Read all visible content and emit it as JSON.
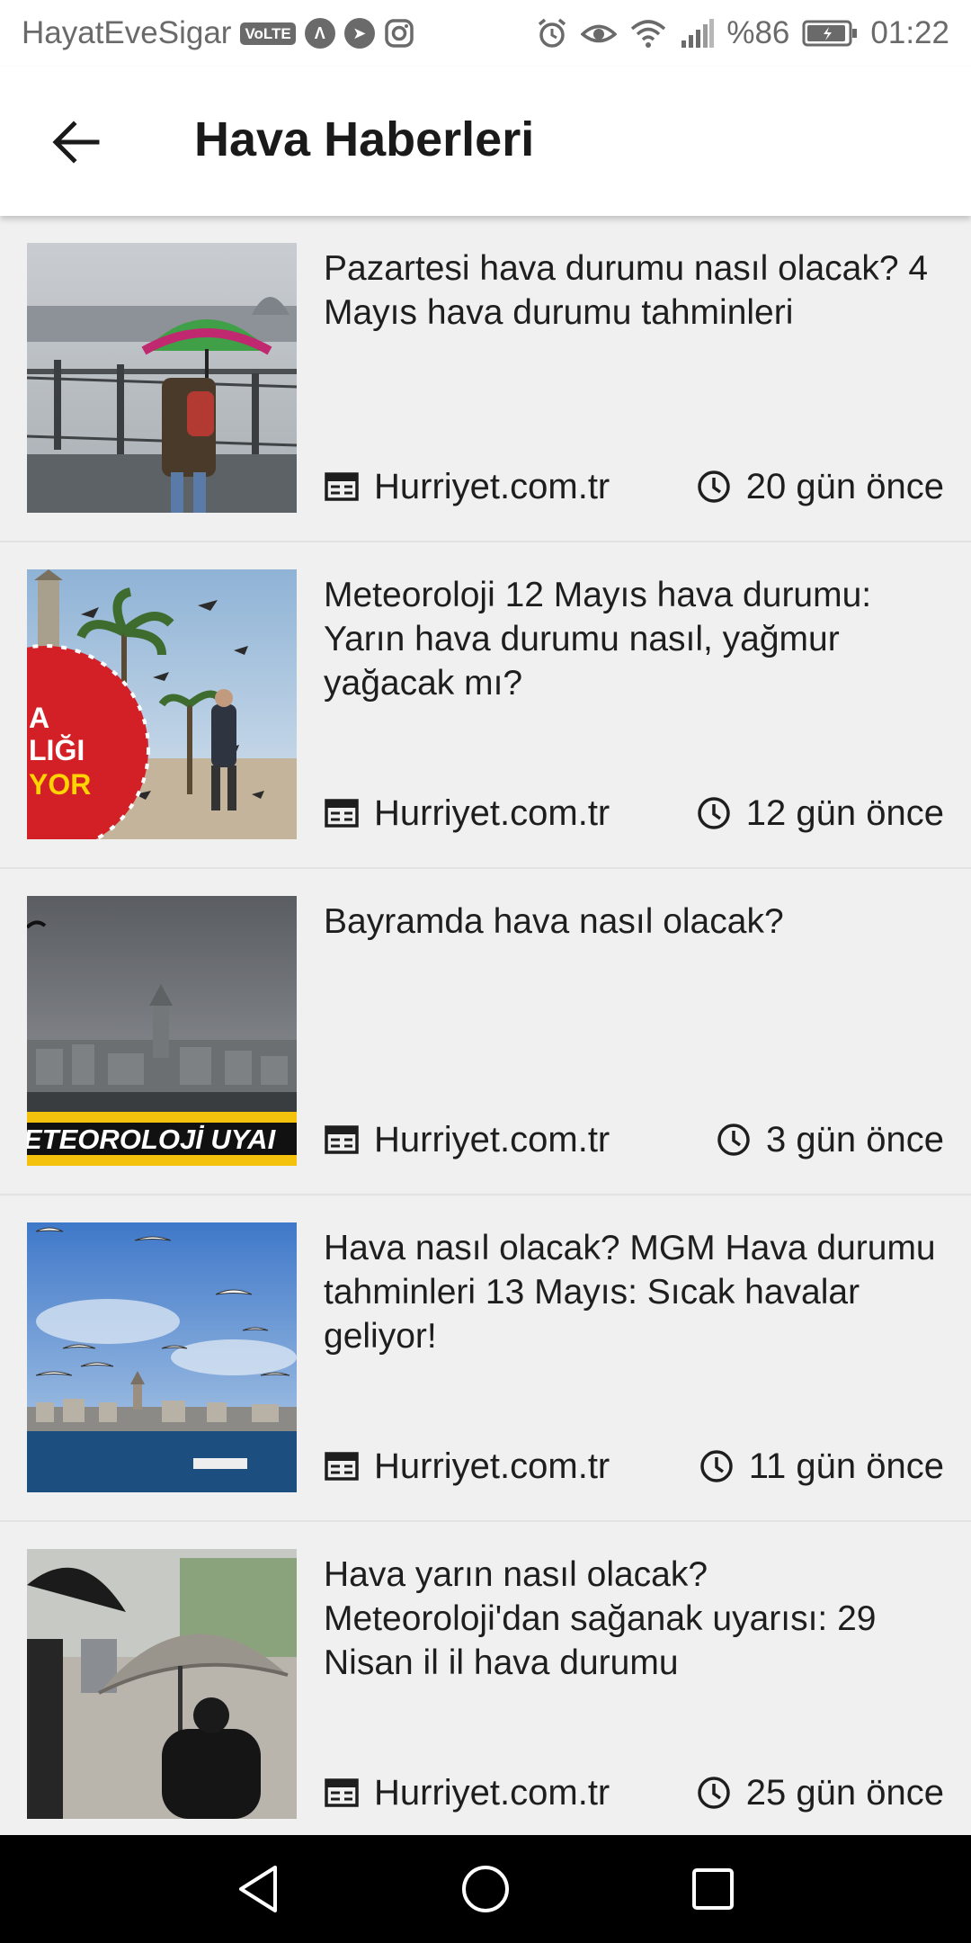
{
  "status_bar": {
    "carrier": "HayatEveSigar",
    "volte": "VoLTE",
    "battery_percent": "%86",
    "time": "01:22",
    "icons": [
      "volte-icon",
      "app-a-icon",
      "telegram-icon",
      "instagram-icon",
      "alarm-icon",
      "eye-icon",
      "wifi-icon",
      "signal-icon",
      "battery-icon"
    ]
  },
  "app_bar": {
    "title": "Hava Haberleri",
    "back_icon": "arrow-back-icon"
  },
  "news": [
    {
      "headline": "Pazartesi hava durumu nasıl olacak? 4 Mayıs hava durumu tahminleri",
      "source": "Hurriyet.com.tr",
      "time": "20 gün önce"
    },
    {
      "headline": "Meteoroloji 12 Mayıs hava durumu: Yarın hava durumu nasıl, yağmur yağacak mı?",
      "source": "Hurriyet.com.tr",
      "time": "12 gün önce",
      "thumb_overlay": [
        "A",
        "LIĞI",
        "YOR"
      ]
    },
    {
      "headline": "Bayramda hava nasıl olacak?",
      "source": "Hurriyet.com.tr",
      "time": "3 gün önce",
      "thumb_overlay": "ETEOROLOJİ UYAI"
    },
    {
      "headline": "Hava nasıl olacak? MGM Hava durumu tahminleri 13 Mayıs: Sıcak havalar geliyor!",
      "source": "Hurriyet.com.tr",
      "time": "11 gün önce"
    },
    {
      "headline": "Hava yarın nasıl olacak? Meteoroloji'dan sağanak uyarısı: 29 Nisan il il hava durumu",
      "source": "Hurriyet.com.tr",
      "time": "25 gün önce"
    }
  ],
  "colors": {
    "list_background": "#f0f0f0",
    "app_bar_background": "#ffffff",
    "nav_bar_background": "#000000",
    "text": "#1e1e1e"
  }
}
